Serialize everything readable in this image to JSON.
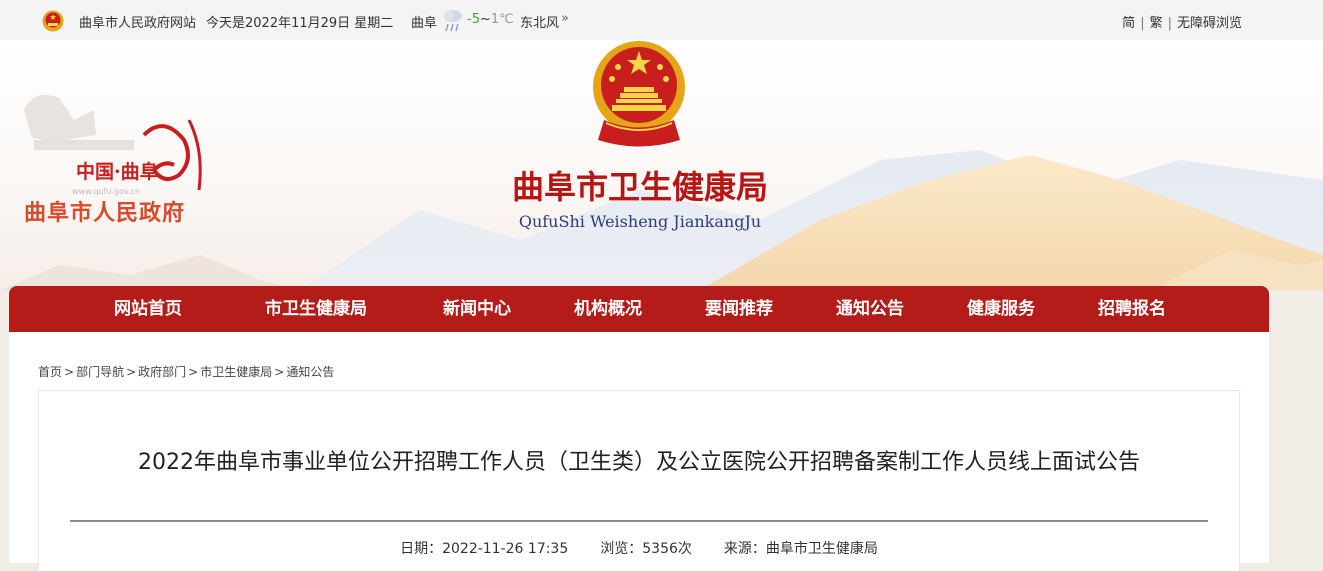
{
  "topbar": {
    "site_name": "曲阜市人民政府网站",
    "date_text": "今天是2022年11月29日 星期二",
    "city": "曲阜",
    "temp_low": "-5",
    "temp_sep": "~",
    "temp_high": "1℃",
    "wind": "东北风",
    "chevron": "»",
    "links": [
      "简",
      "繁",
      "无障碍浏览"
    ],
    "separator": "|"
  },
  "banner": {
    "logo_brand": "中国·曲阜",
    "logo_url_text": "www.qufu.gov.cn",
    "gov_name": "曲阜市人民政府",
    "title": "曲阜市卫生健康局",
    "subtitle": "QufuShi Weisheng JiankangJu"
  },
  "nav": {
    "items": [
      "网站首页",
      "市卫生健康局",
      "新闻中心",
      "机构概况",
      "要闻推荐",
      "通知公告",
      "健康服务",
      "招聘报名"
    ]
  },
  "breadcrumb": {
    "items": [
      "首页",
      "部门导航",
      "政府部门",
      "市卫生健康局",
      "通知公告"
    ],
    "separator": ">"
  },
  "article": {
    "title": "2022年曲阜市事业单位公开招聘工作人员（卫生类）及公立医院公开招聘备案制工作人员线上面试公告",
    "date_label": "日期：",
    "date": "2022-11-26 17:35",
    "views_label": "浏览：",
    "views": "5356次",
    "source_label": "来源：",
    "source": "曲阜市卫生健康局"
  },
  "colors": {
    "nav_bg": "#b31c18",
    "title_red": "#b71513",
    "subtitle_blue": "#2c3c7c",
    "brand_orange": "#d84a2a"
  }
}
